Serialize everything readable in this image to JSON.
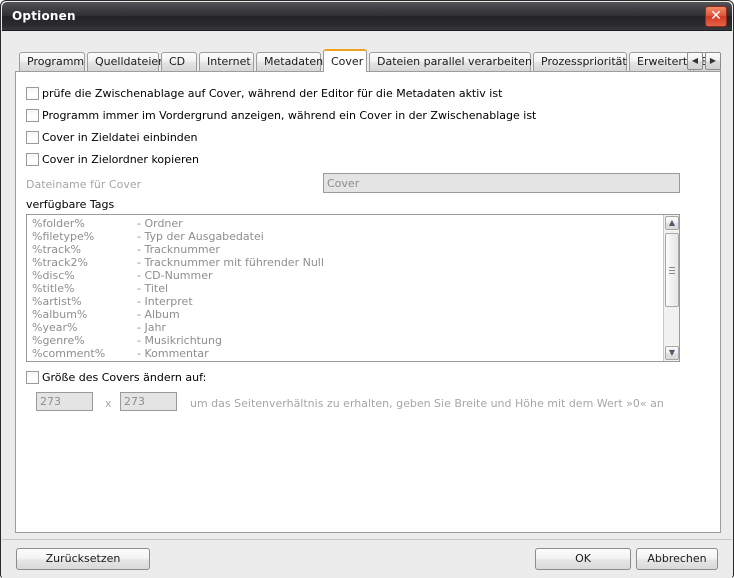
{
  "window": {
    "title": "Optionen",
    "close_label": "✕"
  },
  "tabs": {
    "items": [
      {
        "label": "Programm",
        "active": false
      },
      {
        "label": "Quelldateien",
        "active": false
      },
      {
        "label": "CD",
        "active": false
      },
      {
        "label": "Internet",
        "active": false
      },
      {
        "label": "Metadaten",
        "active": false
      },
      {
        "label": "Cover",
        "active": true
      },
      {
        "label": "Dateien parallel verarbeiten",
        "active": false
      },
      {
        "label": "Prozesspriorität",
        "active": false
      },
      {
        "label": "Erweitert",
        "active": false
      },
      {
        "label": "Erw",
        "active": false
      }
    ],
    "scroll_prev": "◀",
    "scroll_next": "▶"
  },
  "cover_tab": {
    "checkboxes": [
      {
        "label": "prüfe die Zwischenablage auf Cover, während der Editor für die Metadaten aktiv ist",
        "checked": false
      },
      {
        "label": "Programm immer im Vordergrund anzeigen, während ein Cover in der Zwischenablage ist",
        "checked": false
      },
      {
        "label": "Cover in Zieldatei einbinden",
        "checked": false
      },
      {
        "label": "Cover in Zielordner kopieren",
        "checked": false
      }
    ],
    "filename_label": "Dateiname für Cover",
    "filename_value": "Cover",
    "tags_label": "verfügbare Tags",
    "tags": [
      {
        "name": "%folder%",
        "desc": "- Ordner"
      },
      {
        "name": "%filetype%",
        "desc": "- Typ der Ausgabedatei"
      },
      {
        "name": "%track%",
        "desc": "- Tracknummer"
      },
      {
        "name": "%track2%",
        "desc": "- Tracknummer mit führender Null"
      },
      {
        "name": "%disc%",
        "desc": "- CD-Nummer"
      },
      {
        "name": "%title%",
        "desc": "- Titel"
      },
      {
        "name": "%artist%",
        "desc": "- Interpret"
      },
      {
        "name": "%album%",
        "desc": "- Album"
      },
      {
        "name": "%year%",
        "desc": "- Jahr"
      },
      {
        "name": "%genre%",
        "desc": "- Musikrichtung"
      },
      {
        "name": "%comment%",
        "desc": "- Kommentar"
      }
    ],
    "resize_checkbox_label": "Größe des Covers ändern auf:",
    "resize_checked": false,
    "width_value": "273",
    "height_value": "273",
    "dimension_separator": "x",
    "resize_hint": "um das Seitenverhältnis zu erhalten, geben Sie Breite und Höhe mit dem Wert »0« an"
  },
  "buttons": {
    "reset": "Zurücksetzen",
    "ok": "OK",
    "cancel": "Abbrechen"
  },
  "scrollbar": {
    "up_arrow": "▲",
    "down_arrow": "▼"
  },
  "colors": {
    "accent": "#f0a020",
    "titlebar": "#2e2e33",
    "close": "#d6381f",
    "panel": "#ffffff",
    "dialog": "#ececec",
    "disabled_text": "#8e8e8e"
  }
}
